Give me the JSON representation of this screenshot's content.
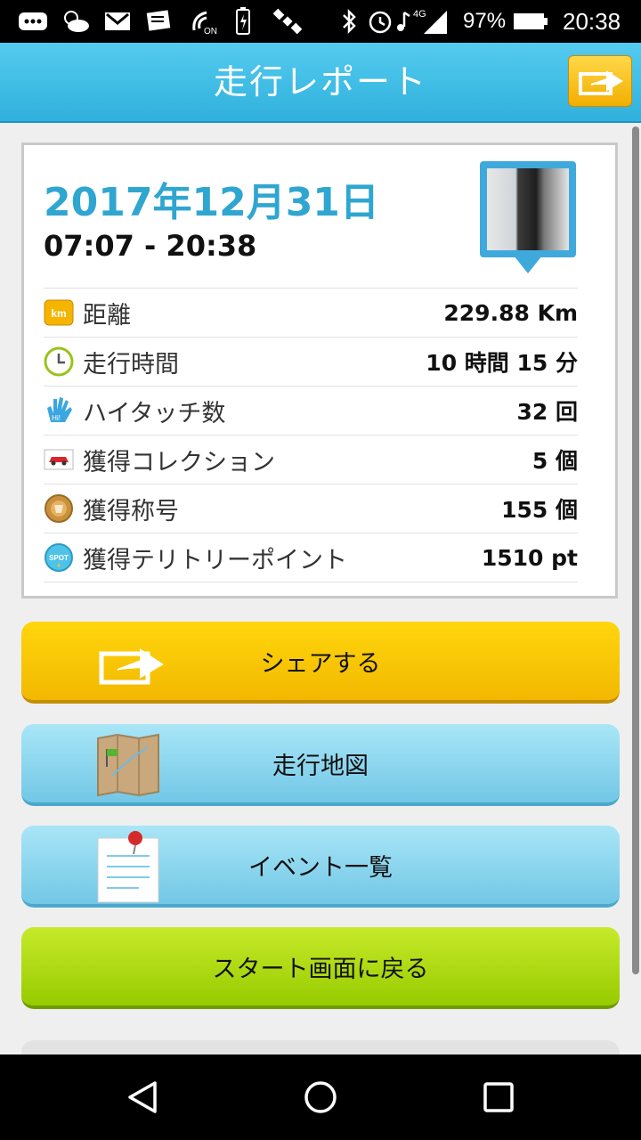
{
  "status_bar": {
    "battery_percent": "97%",
    "time": "20:38",
    "network": "4G"
  },
  "header": {
    "title": "走行レポート"
  },
  "report": {
    "date": "2017年12月31日",
    "time_range": "07:07 - 20:38",
    "stats": [
      {
        "icon": "km-icon",
        "icon_text": "km",
        "label": "距離",
        "value": "229.88 Km"
      },
      {
        "icon": "clock-icon",
        "label": "走行時間",
        "value": "10 時間 15 分"
      },
      {
        "icon": "hand-icon",
        "icon_text": "Hi!",
        "label": "ハイタッチ数",
        "value": "32 回"
      },
      {
        "icon": "car-icon",
        "label": "獲得コレクション",
        "value": "5 個"
      },
      {
        "icon": "medal-icon",
        "label": "獲得称号",
        "value": "155 個"
      },
      {
        "icon": "spot-icon",
        "icon_text": "SPOT",
        "label": "獲得テリトリーポイント",
        "value": "1510 pt"
      }
    ]
  },
  "buttons": {
    "share": "シェアする",
    "map": "走行地図",
    "events": "イベント一覧",
    "back_to_start": "スタート画面に戻る"
  },
  "colors": {
    "header": "#2fb1dd",
    "date_text": "#2fa6d0",
    "share_button": "#f2b800",
    "map_button": "#72c7e6",
    "start_button": "#97cb00"
  }
}
